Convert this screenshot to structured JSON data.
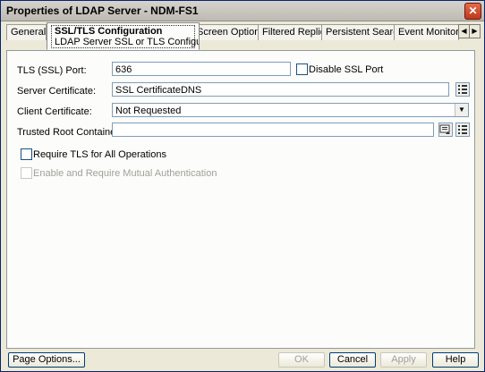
{
  "window": {
    "title": "Properties of LDAP Server - NDM-FS1",
    "close_glyph": "✕"
  },
  "tabs": {
    "general": "General",
    "active_title": "SSL/TLS Configuration",
    "active_sub": "LDAP Server SSL or TLS Configuration",
    "screen_options": "Screen Options",
    "filtered_replica": "Filtered Replica",
    "persistent_search": "Persistent Search",
    "event_monitoring": "Event Monitorin",
    "scroll_left": "◀",
    "scroll_right": "▶"
  },
  "form": {
    "tls_port_label": "TLS (SSL) Port:",
    "tls_port_value": "636",
    "disable_ssl_label": "Disable SSL Port",
    "disable_ssl_checked": false,
    "server_cert_label": "Server Certificate:",
    "server_cert_value": "SSL CertificateDNS",
    "client_cert_label": "Client Certificate:",
    "client_cert_value": "Not Requested",
    "trusted_root_label": "Trusted Root Containers:",
    "trusted_root_value": "",
    "require_tls_label": "Require TLS for All Operations",
    "require_tls_checked": false,
    "mutual_auth_label": "Enable and Require Mutual Authentication",
    "mutual_auth_checked": false,
    "dropdown_glyph": "▼"
  },
  "footer": {
    "page_options": "Page Options...",
    "ok": "OK",
    "cancel": "Cancel",
    "apply": "Apply",
    "help": "Help"
  }
}
